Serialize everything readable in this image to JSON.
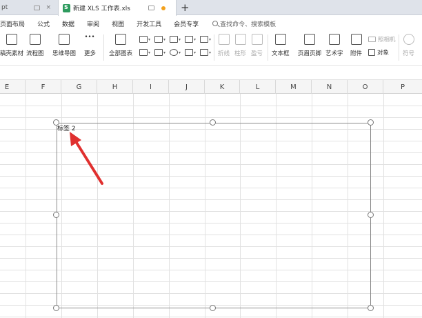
{
  "tabs": {
    "inactive": {
      "title": "pt"
    },
    "active": {
      "title": "新建 XLS 工作表.xls"
    },
    "new_tab": "+"
  },
  "menu": {
    "items": [
      "页面布局",
      "公式",
      "数据",
      "审阅",
      "视图",
      "开发工具",
      "会员专享"
    ],
    "search_placeholder": "查找命令、搜索模板"
  },
  "ribbon": {
    "buttons": [
      "稿壳素材",
      "流程图",
      "思维导图",
      "更多",
      "全部图表",
      "折线",
      "柱形",
      "盈亏",
      "文本框",
      "页眉页脚",
      "艺术字",
      "附件",
      "对象",
      "符号"
    ],
    "camera_label": "照相机"
  },
  "columns": [
    "E",
    "F",
    "G",
    "H",
    "I",
    "J",
    "K",
    "L",
    "M",
    "N",
    "O",
    "P"
  ],
  "textbox": {
    "label": "标签 2"
  },
  "colors": {
    "accent_red": "#e0302f",
    "tab_dot": "#f3a11d",
    "doc_icon": "#2e9b5e"
  }
}
